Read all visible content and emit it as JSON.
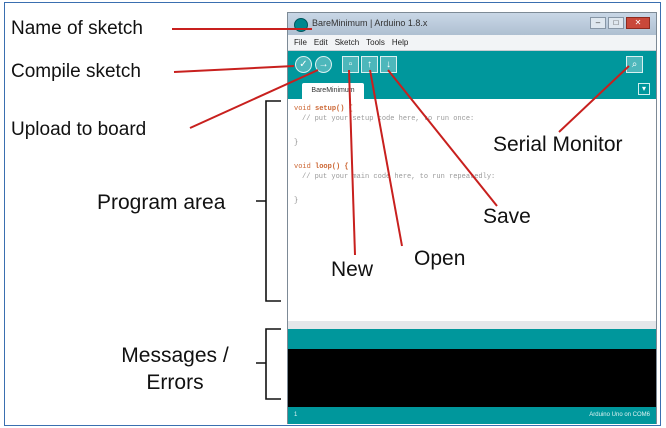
{
  "labels": {
    "name_of_sketch": "Name of sketch",
    "compile_sketch": "Compile sketch",
    "upload_to_board": "Upload to board",
    "program_area": "Program area",
    "messages_line1": "Messages /",
    "messages_line2": "Errors",
    "serial_monitor": "Serial Monitor",
    "save": "Save",
    "open": "Open",
    "new": "New"
  },
  "ide": {
    "title": "BareMinimum | Arduino 1.8.x",
    "menu": [
      "File",
      "Edit",
      "Sketch",
      "Tools",
      "Help"
    ],
    "tab_label": "BareMinimum",
    "code": {
      "setup_keyword": "void",
      "setup_name": "setup() {",
      "setup_comment": "// put your setup code here, to run once:",
      "close1": "}",
      "loop_keyword": "void",
      "loop_name": "loop() {",
      "loop_comment": "// put your main code here, to run repeatedly:",
      "close2": "}"
    },
    "footer_line": "1",
    "footer_board": "Arduino Uno on COM6"
  },
  "colors": {
    "toolbar": "#00979c",
    "arrow": "#c8201e",
    "console": "#000000"
  }
}
